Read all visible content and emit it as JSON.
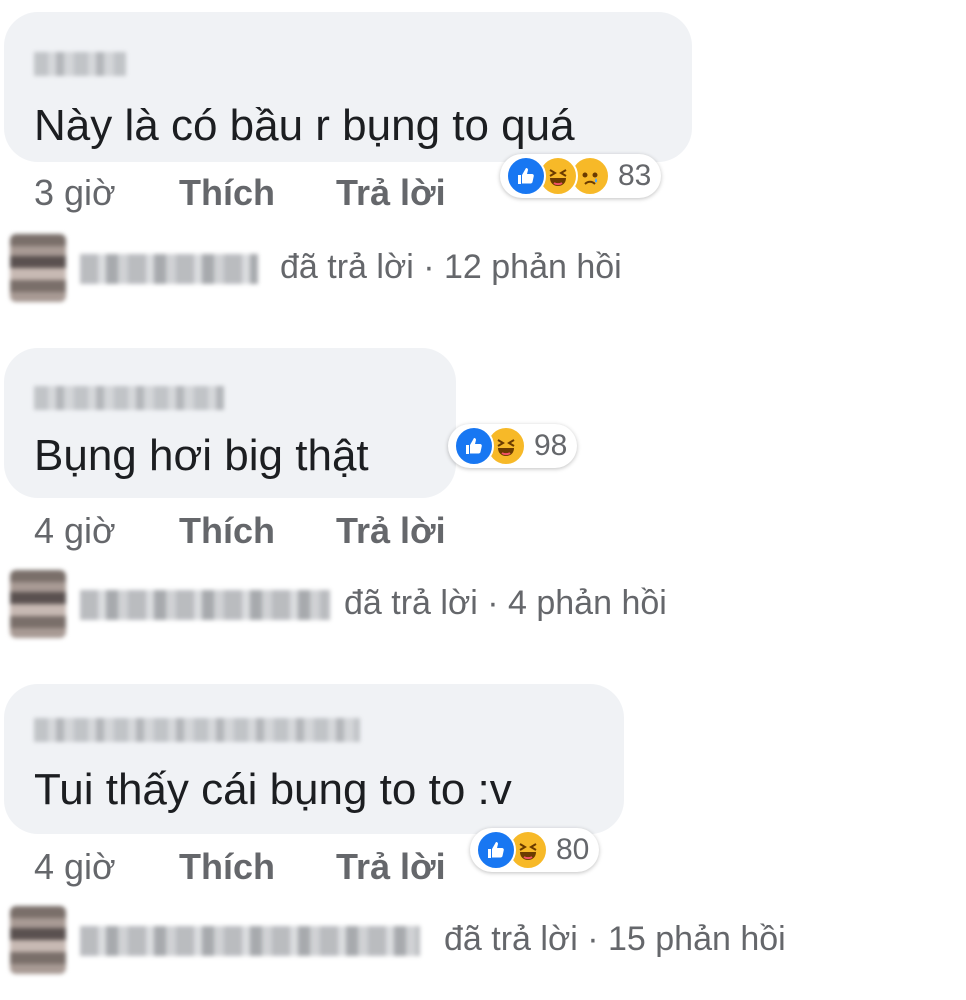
{
  "comments": [
    {
      "text": "Này là có bầu r bụng to quá",
      "time": "3 giờ",
      "like_label": "Thích",
      "reply_label": "Trả lời",
      "reactions": [
        "like-icon",
        "haha-icon",
        "sad-icon"
      ],
      "reaction_count": "83",
      "reply_summary": "đã trả lời · 12 phản hồi"
    },
    {
      "text": "Bụng hơi big thật",
      "time": "4 giờ",
      "like_label": "Thích",
      "reply_label": "Trả lời",
      "reactions": [
        "like-icon",
        "haha-icon"
      ],
      "reaction_count": "98",
      "reply_summary": "đã trả lời · 4 phản hồi"
    },
    {
      "text": "Tui thấy cái bụng to to :v",
      "time": "4 giờ",
      "like_label": "Thích",
      "reply_label": "Trả lời",
      "reactions": [
        "like-icon",
        "haha-icon"
      ],
      "reaction_count": "80",
      "reply_summary": "đã trả lời · 15 phản hồi"
    }
  ],
  "colors": {
    "bubble": "#f0f2f5",
    "like": "#1877f2",
    "haha": "#f7b928",
    "meta": "#65676b"
  }
}
